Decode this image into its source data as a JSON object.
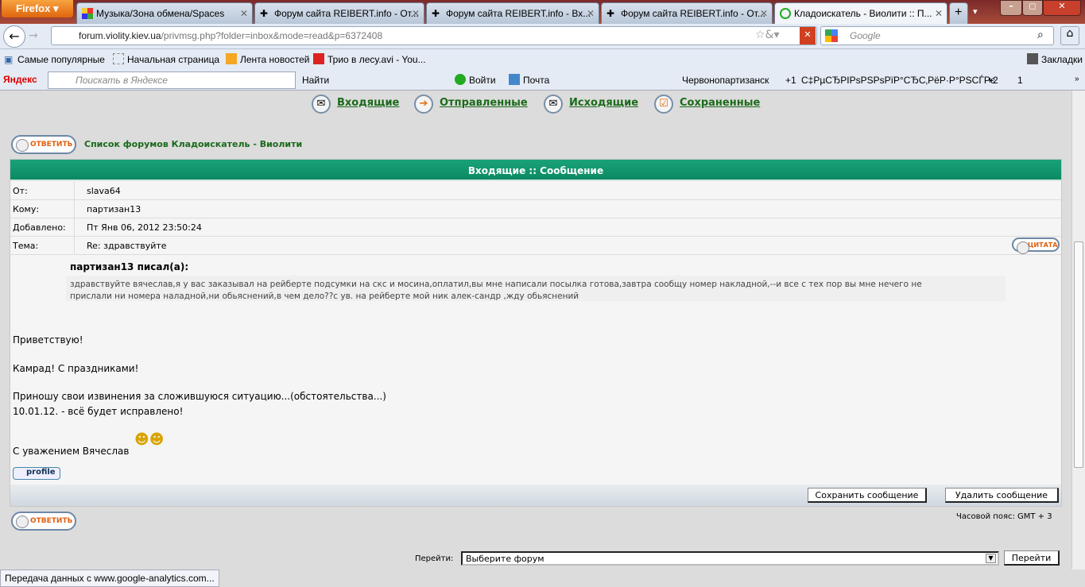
{
  "browser": {
    "menu_label": "Firefox",
    "tabs": [
      {
        "label": "Музыка/Зона обмена/Spaces"
      },
      {
        "label": "Форум сайта REIBERT.info - От..."
      },
      {
        "label": "Форум сайта REIBERT.info - Вх..."
      },
      {
        "label": "Форум сайта REIBERT.info - От..."
      },
      {
        "label": "Кладоискатель - Виолити :: П..."
      }
    ],
    "url_host": "forum.violity.kiev.ua",
    "url_path": "/privmsg.php?folder=inbox&mode=read&p=6372408",
    "search_placeholder": "Google",
    "bookmarks": [
      "Самые популярные",
      "Начальная страница",
      "Лента новостей",
      "Трио в лесу.avi - You..."
    ],
    "bookmarks_menu": "Закладки",
    "yandex": {
      "logo": "Яндекс",
      "placeholder": "Поискать в Яндексе",
      "find": "Найти",
      "login": "Войти",
      "mail": "Почта",
      "city": "Червонопартизанск",
      "t1": "+1",
      "garbled": "С‡РµСЂРІРѕРЅРѕРїР°СЂС‚РёР·Р°РЅСЃРє",
      "t2": "+2",
      "t3": "1"
    },
    "status": "Передача данных с www.google-analytics.com..."
  },
  "forum": {
    "nav": [
      "Входящие",
      "Отправленные",
      "Исходящие",
      "Сохраненные"
    ],
    "reply_label": "ОТВЕТИТЬ",
    "breadcrumb": "Список форумов Кладоискатель - Виолити",
    "header": "Входящие :: Сообщение",
    "fields": [
      {
        "label": "От:",
        "value": "slava64"
      },
      {
        "label": "Кому:",
        "value": "партизан13"
      },
      {
        "label": "Добавлено:",
        "value": "Пт Янв 06, 2012 23:50:24"
      },
      {
        "label": "Тема:",
        "value": "Re: здравствуйте"
      }
    ],
    "quote_label": "ЦИТАТА",
    "quote_author": "партизан13 писал(а):",
    "quote_line1": "здравствуйте вячеслав,я у вас заказывал на рейберте подсумки на скс и мосина,оплатил,вы мне написали посылка готова,завтра сообщу номер накладной,--и все с тех пор вы мне нечего не",
    "quote_line2": "прислали ни номера наладной,ни обьяснений,в чем дело??с ув. на рейберте мой ник алек-сандр ,жду обьяснений",
    "body": [
      "Приветствую!",
      "Камрад! С праздниками!",
      "Приношу свои извинения за сложившуюся ситуацию...(обстоятельства...)",
      "10.01.12. - всё будет исправлено!",
      "С уважением Вячеслав"
    ],
    "profile_label": "profile",
    "save_label": "Сохранить сообщение",
    "delete_label": "Удалить сообщение",
    "timezone": "Часовой пояс: GMT + 3",
    "jump_label": "Перейти:",
    "jump_value": "Выберите форум",
    "jump_button": "Перейти"
  },
  "colors": {
    "header_green": "#0f9468",
    "link_green": "#1a6a1a",
    "reply_orange": "#e06010"
  }
}
